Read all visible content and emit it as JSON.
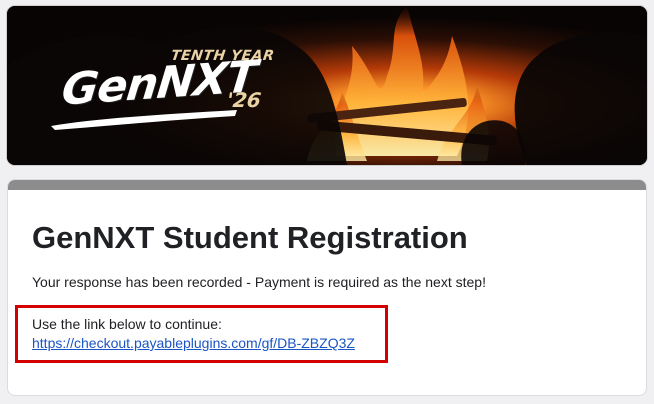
{
  "banner": {
    "logo_tagline": "TENTH YEAR",
    "logo_word": "GenNXT",
    "logo_year": "'26",
    "logo_alt": "GenNXT '26 Tenth Year campfire banner"
  },
  "form": {
    "title": "GenNXT Student Registration",
    "confirmation_message": "Your response has been recorded - Payment is required as the next step!",
    "continue_text": "Use the link below to continue:",
    "checkout_link_text": "https://checkout.payableplugins.com/gf/DB-ZBZQ3Z"
  },
  "colors": {
    "page_background": "#f0f0f2",
    "card_topbar": "#8c8c8c",
    "highlight_border": "#d40000",
    "link": "#1a55c6"
  },
  "icons": {
    "banner_image": "campfire-image"
  }
}
